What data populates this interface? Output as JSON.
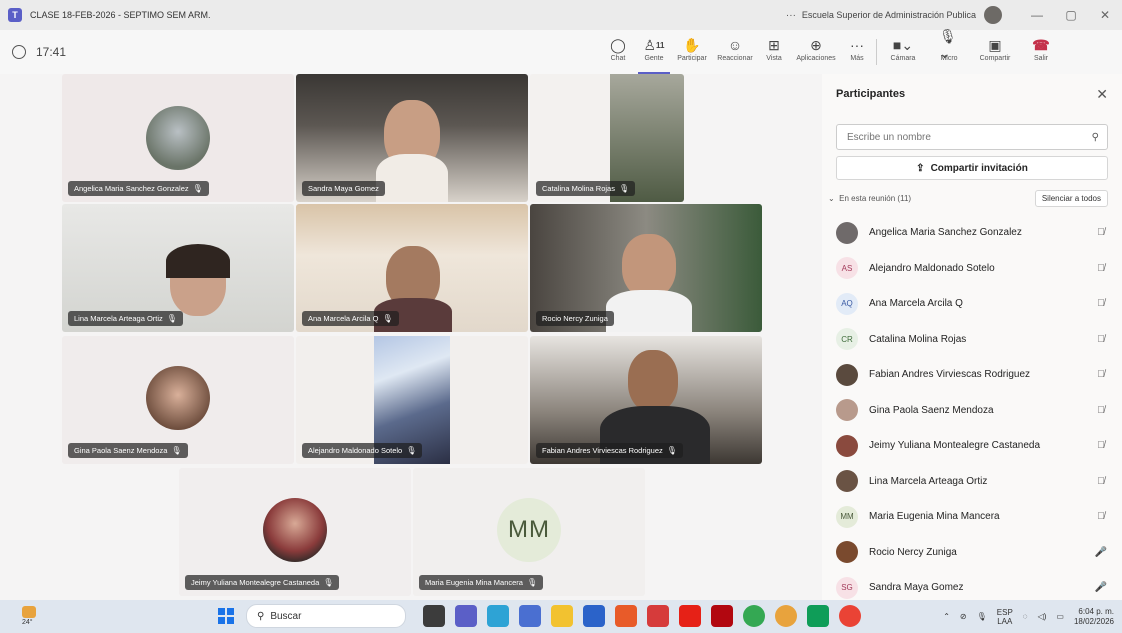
{
  "window": {
    "title": "CLASE 18-FEB-2026 - SEPTIMO SEM ARM.",
    "org": "Escuela Superior de Administración Publica",
    "more": "···"
  },
  "toolbar": {
    "timer": "17:41",
    "people_count": "11",
    "buttons": {
      "chat": "Chat",
      "people": "Gente",
      "raise": "Participar",
      "react": "Reaccionar",
      "view": "Vista",
      "apps": "Aplicaciones",
      "more": "Más",
      "camera": "Cámara",
      "mic": "Micro",
      "share": "Compartir",
      "leave": "Salir"
    }
  },
  "tiles": {
    "t1": {
      "name": "Angelica Maria Sanchez Gonzalez"
    },
    "t2": {
      "name": "Sandra Maya Gomez"
    },
    "t3": {
      "name": "Catalina Molina Rojas"
    },
    "t4": {
      "name": "Lina Marcela Arteaga Ortiz"
    },
    "t5": {
      "name": "Ana Marcela Arcila Q"
    },
    "t6": {
      "name": "Rocio Nercy Zuniga"
    },
    "t7": {
      "name": "Gina Paola Saenz Mendoza"
    },
    "t8": {
      "name": "Alejandro Maldonado Sotelo"
    },
    "t9": {
      "name": "Fabian Andres Virviescas Rodriguez"
    },
    "t10": {
      "name": "Jeimy Yuliana Montealegre Castaneda"
    },
    "t11": {
      "name": "Maria Eugenia Mina Mancera",
      "initials": "MM"
    }
  },
  "panel": {
    "title": "Participantes",
    "search_placeholder": "Escribe un nombre",
    "invite_label": "Compartir invitación",
    "section_label": "En esta reunión (11)",
    "mute_all_label": "Silenciar a todos",
    "participants": [
      {
        "name": "Angelica Maria Sanchez Gonzalez",
        "initials": "",
        "muted": true
      },
      {
        "name": "Alejandro Maldonado Sotelo",
        "initials": "AS",
        "muted": true
      },
      {
        "name": "Ana Marcela Arcila Q",
        "initials": "AQ",
        "muted": true
      },
      {
        "name": "Catalina Molina Rojas",
        "initials": "CR",
        "muted": true
      },
      {
        "name": "Fabian Andres Virviescas Rodriguez",
        "initials": "",
        "muted": true
      },
      {
        "name": "Gina Paola Saenz Mendoza",
        "initials": "",
        "muted": true
      },
      {
        "name": "Jeimy Yuliana Montealegre Castaneda",
        "initials": "",
        "muted": true
      },
      {
        "name": "Lina Marcela Arteaga Ortiz",
        "initials": "",
        "muted": true
      },
      {
        "name": "Maria Eugenia Mina Mancera",
        "initials": "MM",
        "muted": true
      },
      {
        "name": "Rocio Nercy Zuniga",
        "initials": "",
        "muted": false
      },
      {
        "name": "Sandra Maya Gomez",
        "initials": "SG",
        "muted": false
      }
    ]
  },
  "taskbar": {
    "weather": "24°",
    "search_label": "Buscar",
    "lang_line1": "ESP",
    "lang_line2": "LAA",
    "time": "6:04 p. m.",
    "date": "18/02/2026"
  },
  "colors": {
    "accent": "#5b5fc7",
    "leave": "#c4314b",
    "taskbar": "#dfe6ef"
  }
}
